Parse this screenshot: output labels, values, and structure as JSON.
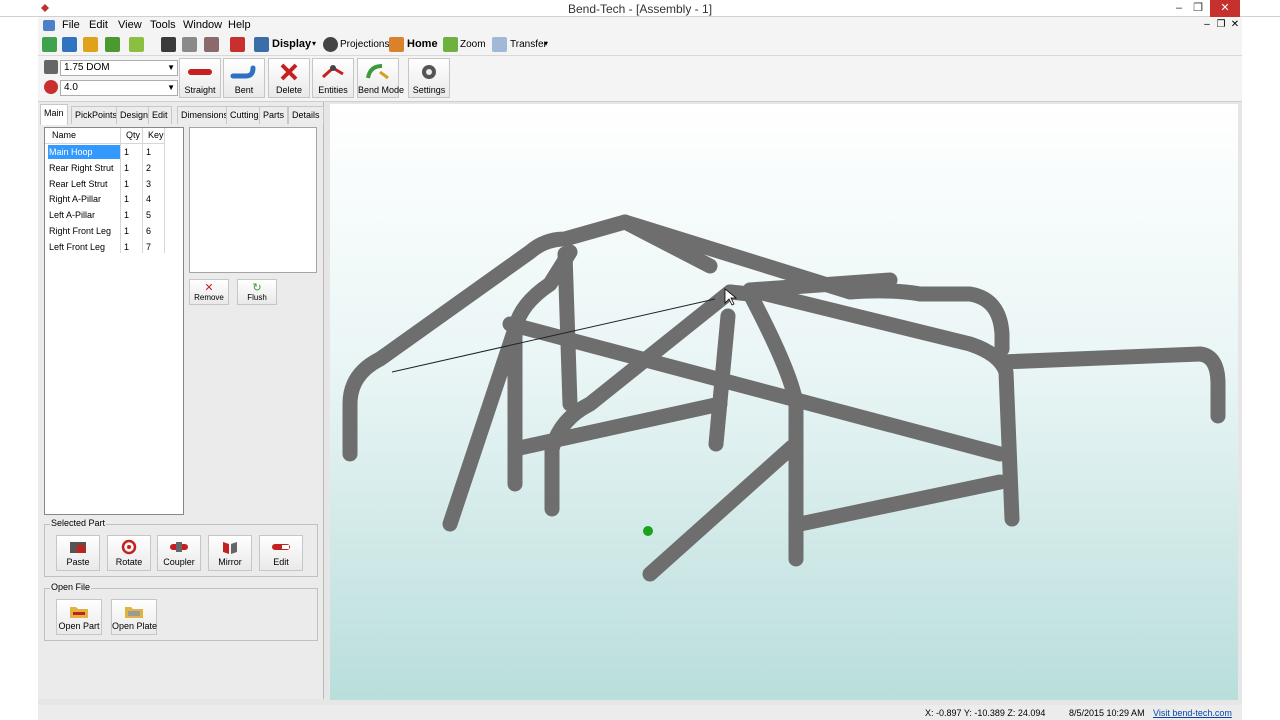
{
  "window": {
    "title": "Bend-Tech - [Assembly - 1]",
    "minimize": "–",
    "restore": "❐",
    "close": "✕",
    "mdi_minimize": "–",
    "mdi_restore": "❐",
    "mdi_close": "✕"
  },
  "menu": [
    "File",
    "Edit",
    "View",
    "Tools",
    "Window",
    "Help"
  ],
  "toolbar1": {
    "display_label": "Display",
    "projections_label": "Projections",
    "home_label": "Home",
    "zoom_label": "Zoom",
    "transfer_label": "Transfer"
  },
  "toolbar2": {
    "material": "1.75 DOM",
    "radius": "4.0",
    "buttons": [
      "Straight",
      "Bent",
      "Delete",
      "Entities",
      "Bend Mode",
      "Settings"
    ]
  },
  "tabs": [
    "Main",
    "PickPoints",
    "Design",
    "Edit",
    "Dimensions",
    "Cutting",
    "Parts",
    "Details"
  ],
  "parts_table": {
    "columns": [
      "Name",
      "Qty",
      "Key"
    ],
    "rows": [
      {
        "name": "Main Hoop",
        "qty": "1",
        "key": "1"
      },
      {
        "name": "Rear Right Strut",
        "qty": "1",
        "key": "2"
      },
      {
        "name": "Rear Left Strut",
        "qty": "1",
        "key": "3"
      },
      {
        "name": "Right A-Pillar",
        "qty": "1",
        "key": "4"
      },
      {
        "name": "Left A-Pillar",
        "qty": "1",
        "key": "5"
      },
      {
        "name": "Right Front Leg",
        "qty": "1",
        "key": "6"
      },
      {
        "name": "Left Front Leg",
        "qty": "1",
        "key": "7"
      }
    ]
  },
  "list_buttons": {
    "remove": "Remove",
    "flush": "Flush"
  },
  "selected_part": {
    "title": "Selected Part",
    "buttons": [
      "Paste",
      "Rotate",
      "Coupler",
      "Mirror",
      "Edit"
    ]
  },
  "open_file": {
    "title": "Open File",
    "buttons": [
      "Open Part",
      "Open Plate"
    ]
  },
  "status": {
    "coords": "X: -0.897  Y: -10.389  Z: 24.094",
    "datetime": "8/5/2015  10:29 AM",
    "link": "Visit bend-tech.com"
  },
  "colors": {
    "tube": "#6e6e6e",
    "selection": "#3399ff",
    "close_button": "#c7312d"
  }
}
